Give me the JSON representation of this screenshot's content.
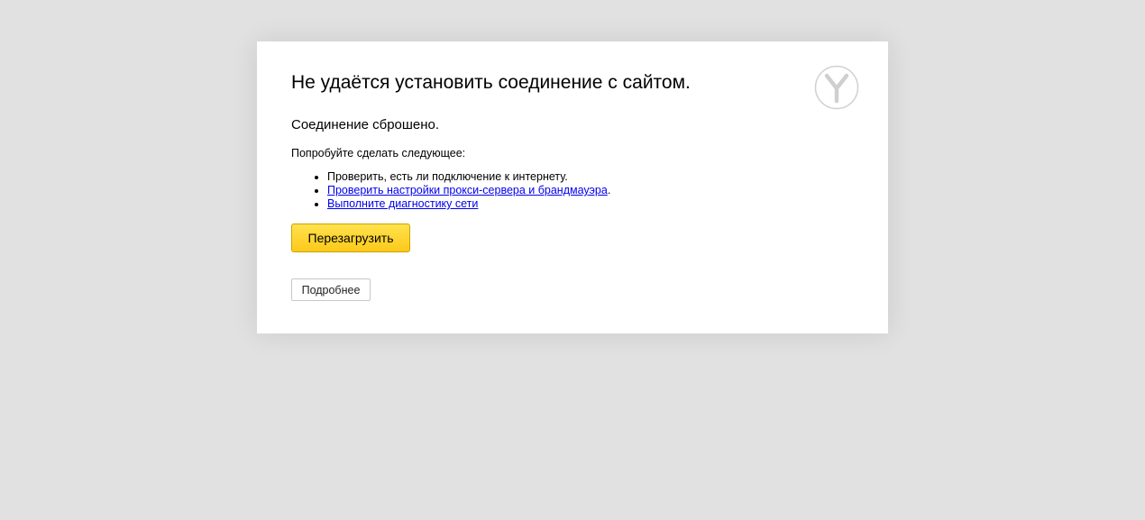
{
  "error_page": {
    "title": "Не удаётся установить соединение с сайтом.",
    "subtitle": "Соединение сброшено.",
    "hint": "Попробуйте сделать следующее:",
    "suggestions": {
      "check_connection": "Проверить, есть ли подключение к интернету.",
      "check_proxy_link": "Проверить настройки прокси-сервера и брандмауэра",
      "check_proxy_suffix": ".",
      "diagnostics_link": "Выполните диагностику сети"
    },
    "reload_button": "Перезагрузить",
    "details_button": "Подробнее",
    "logo_icon": "yandex-browser-logo-icon"
  },
  "colors": {
    "page_background": "#e1e1e1",
    "card_background": "#ffffff",
    "reload_button": "#ffd633",
    "link": "#0000ee"
  }
}
